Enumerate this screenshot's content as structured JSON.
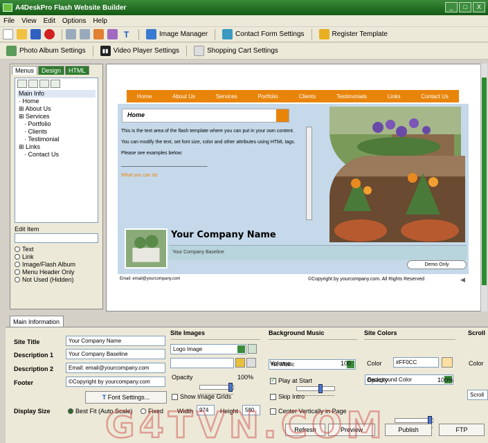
{
  "window": {
    "title": "A4DeskPro Flash Website Builder",
    "controls": [
      "_",
      "□",
      "X"
    ]
  },
  "menu": [
    "File",
    "View",
    "Edit",
    "Options",
    "Help"
  ],
  "toolbar1": {
    "image_manager": "Image Manager",
    "contact_form": "Contact Form Settings",
    "register": "Register Template"
  },
  "toolbar2": {
    "photo_album": "Photo Album Settings",
    "video_player": "Video Player Settings",
    "shopping_cart": "Shopping Cart Settings"
  },
  "left_panel": {
    "tabs": [
      "Menus",
      "Design",
      "HTML"
    ],
    "tree": [
      {
        "label": "Main Info",
        "prefix": "",
        "selected": true
      },
      {
        "label": "Home",
        "prefix": "· ",
        "selected": false
      },
      {
        "label": "About Us",
        "prefix": "⊞ ",
        "selected": false
      },
      {
        "label": "Services",
        "prefix": "⊞ ",
        "selected": false
      },
      {
        "label": "Portfolio",
        "prefix": "  · ",
        "selected": false
      },
      {
        "label": "Clients",
        "prefix": "  · ",
        "selected": false
      },
      {
        "label": "Testimonial",
        "prefix": "  · ",
        "selected": false
      },
      {
        "label": "Links",
        "prefix": "⊞ ",
        "selected": false
      },
      {
        "label": "Contact Us",
        "prefix": "  · ",
        "selected": false
      }
    ],
    "edit_item_label": "Edit Item",
    "item_types": [
      "Text",
      "Link",
      "Image/Flash Album",
      "Menu Header Only",
      "Not Used (Hidden)"
    ]
  },
  "preview": {
    "nav": [
      "Home",
      "About Us",
      "Services",
      "Portfolio",
      "Clients",
      "Testimonials",
      "Links",
      "Contact Us"
    ],
    "page_title": "Home",
    "paragraphs": [
      "This is the text area of the flash template where you can put in your own content.",
      "You can modify the text, set font size, color and other attributes using HTML tags.",
      "Please see examples below:",
      "________________________________",
      "What you can do"
    ],
    "company_name": "Your Company Name",
    "company_baseline": "Your Company Baseline",
    "demo_button": "Demo Only",
    "footer_email": "Email: email@yourcompany.com",
    "footer_copyright": "©Copyright by yourcompany.com. All Rights Reserved"
  },
  "bottom": {
    "tab": "Main Information",
    "site_title_label": "Site Title",
    "site_title_value": "Your Company Name",
    "desc1_label": "Description 1",
    "desc1_value": "Your Company Baseline",
    "desc2_label": "Description 2",
    "desc2_value": "Email: email@yourcompany.com",
    "footer_label": "Footer",
    "footer_value": "©Copyright by yourcompany.com",
    "font_settings": "Font Settings...",
    "display_size_label": "Display Size",
    "best_fit": "Best Fit (Auto Scale)",
    "fixed": "Fixed",
    "width_label": "Width",
    "width_value": "974",
    "height_label": "Height",
    "height_value": "580",
    "site_images": {
      "title": "Site Images",
      "combo": "Logo Image",
      "opacity_label": "Opacity",
      "opacity_value": "100%",
      "opacity_level": 1.0,
      "show_grids": "Show Image Grids"
    },
    "music": {
      "title": "Background Music",
      "combo": "No Music",
      "volume_label": "Volume",
      "volume_value": "100",
      "volume_level": 0.65,
      "play_at_start": "Play at Start",
      "skip_intro": "Skip Intro",
      "center_vert": "Center Vertically in Page"
    },
    "colors": {
      "title": "Site Colors",
      "combo": "Background Color",
      "color_label": "Color",
      "color_value": "#FF0CC",
      "swatch": "#ffe0a0",
      "opacity_label": "Opacity",
      "opacity_value": "100%",
      "opacity_level": 1.0
    },
    "scroll": {
      "title": "Scroll",
      "combo": "Scroll",
      "color_label": "Color"
    },
    "buttons": {
      "refresh": "Refresh",
      "preview": "Preview",
      "publish": "Publish",
      "ftp": "FTP"
    }
  },
  "watermark": "G4TVN.COM"
}
